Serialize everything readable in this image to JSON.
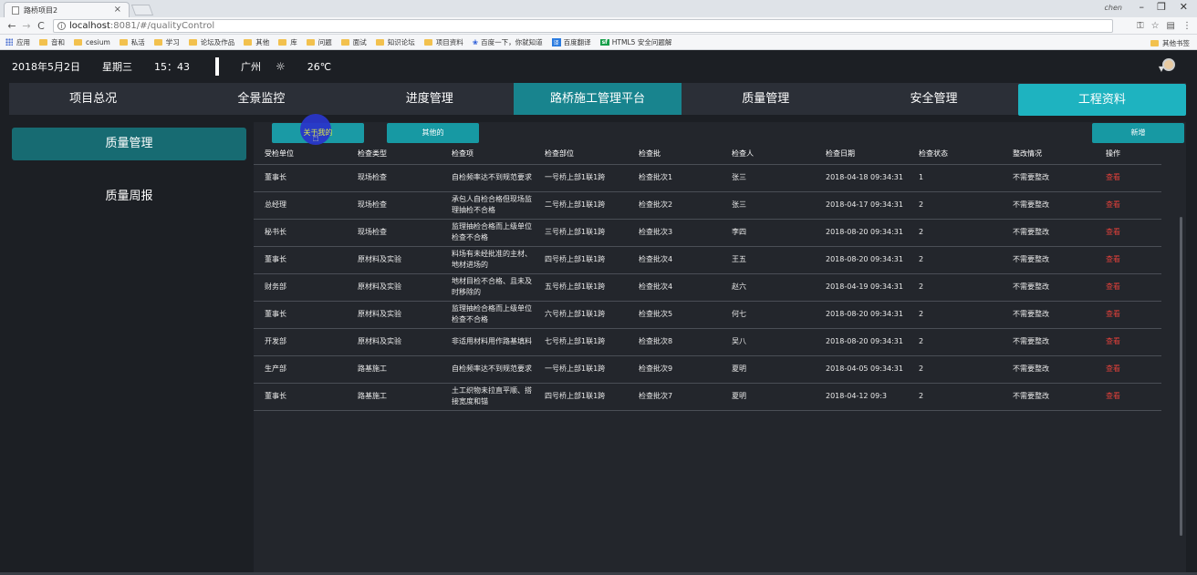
{
  "browser": {
    "tab_title": "路桥项目2",
    "tab_close": "×",
    "user_name": "chen",
    "url_host": "localhost",
    "url_path": ":8081/#/qualityControl",
    "bookmarks": [
      "应用",
      "音和",
      "cesium",
      "私活",
      "学习",
      "论坛及作品",
      "其他",
      "库",
      "问题",
      "面试",
      "知识论坛",
      "项目资料",
      "百度一下，你就知道",
      "百度翻译",
      "HTML5 安全问题解"
    ],
    "other_bookmarks": "其他书签"
  },
  "topinfo": {
    "date": "2018年5月2日",
    "weekday": "星期三",
    "time": "15：43",
    "city": "广州",
    "weather_icon": "sun-icon",
    "temperature": "26℃"
  },
  "nav": {
    "items": [
      "项目总况",
      "全景监控",
      "进度管理",
      "路桥施工管理平台",
      "质量管理",
      "安全管理",
      "工程资料"
    ]
  },
  "sidebar": {
    "items": [
      "质量管理",
      "质量周报"
    ]
  },
  "toolbar": {
    "mine_label": "关于我的",
    "other_label": "其他的",
    "add_label": "新增"
  },
  "table": {
    "headers": [
      "受检单位",
      "检查类型",
      "检查项",
      "检查部位",
      "检查批",
      "检查人",
      "检查日期",
      "检查状态",
      "整改情况",
      "操作"
    ],
    "rows": [
      [
        "董事长",
        "现场检查",
        "自检频率达不到规范要求",
        "一号桥上部1联1跨",
        "检查批次1",
        "张三",
        "2018-04-18 09:34:31",
        "1",
        "不需要整改",
        "查看"
      ],
      [
        "总经理",
        "现场检查",
        "承包人自检合格但现场监理抽检不合格",
        "二号桥上部1联1跨",
        "检查批次2",
        "张三",
        "2018-04-17 09:34:31",
        "2",
        "不需要整改",
        "查看"
      ],
      [
        "秘书长",
        "现场检查",
        "监理抽检合格而上级单位检查不合格",
        "三号桥上部1联1跨",
        "检查批次3",
        "李四",
        "2018-08-20 09:34:31",
        "2",
        "不需要整改",
        "查看"
      ],
      [
        "董事长",
        "原材料及实验",
        "料场有未经批准的主材、地材进场的",
        "四号桥上部1联1跨",
        "检查批次4",
        "王五",
        "2018-08-20 09:34:31",
        "2",
        "不需要整改",
        "查看"
      ],
      [
        "财务部",
        "原材料及实验",
        "地材目检不合格、且未及时移除的",
        "五号桥上部1联1跨",
        "检查批次4",
        "赵六",
        "2018-04-19 09:34:31",
        "2",
        "不需要整改",
        "查看"
      ],
      [
        "董事长",
        "原材料及实验",
        "监理抽检合格而上级单位检查不合格",
        "六号桥上部1联1跨",
        "检查批次5",
        "何七",
        "2018-08-20 09:34:31",
        "2",
        "不需要整改",
        "查看"
      ],
      [
        "开发部",
        "原材料及实验",
        "非适用材料用作路基填料",
        "七号桥上部1联1跨",
        "检查批次8",
        "吴八",
        "2018-08-20 09:34:31",
        "2",
        "不需要整改",
        "查看"
      ],
      [
        "生产部",
        "路基施工",
        "自检频率达不到规范要求",
        "一号桥上部1联1跨",
        "检查批次9",
        "夏明",
        "2018-04-05 09:34:31",
        "2",
        "不需要整改",
        "查看"
      ],
      [
        "董事长",
        "路基施工",
        "土工织物未拉直平顺、搭接宽度和锚",
        "四号桥上部1联1跨",
        "检查批次7",
        "夏明",
        "2018-04-12 09:3",
        "2",
        "不需要整改",
        "查看"
      ]
    ]
  }
}
